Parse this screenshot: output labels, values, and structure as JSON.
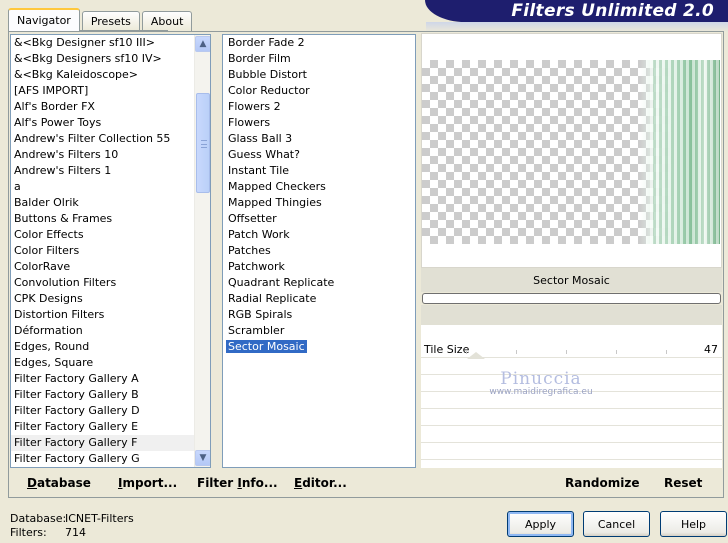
{
  "banner": {
    "title": "Filters Unlimited 2.0"
  },
  "tabs": [
    {
      "label": "Navigator",
      "active": true
    },
    {
      "label": "Presets",
      "active": false
    },
    {
      "label": "About",
      "active": false
    }
  ],
  "categories": {
    "items": [
      "&<Bkg Designer sf10 III>",
      "&<Bkg Designers sf10 IV>",
      "&<Bkg Kaleidoscope>",
      "[AFS IMPORT]",
      "Alf's Border FX",
      "Alf's Power Toys",
      "Andrew's Filter Collection 55",
      "Andrew's Filters 10",
      "Andrew's Filters 1",
      "a",
      "Balder Olrik",
      "Buttons & Frames",
      "Color Effects",
      "Color Filters",
      "ColorRave",
      "Convolution Filters",
      "CPK Designs",
      "Distortion Filters",
      "Déformation",
      "Edges, Round",
      "Edges, Square",
      "Filter Factory Gallery A",
      "Filter Factory Gallery B",
      "Filter Factory Gallery D",
      "Filter Factory Gallery E",
      "Filter Factory Gallery F",
      "Filter Factory Gallery G"
    ],
    "selected_index": 25
  },
  "filters": {
    "items": [
      "Border Fade 2",
      "Border Film",
      "Bubble Distort",
      "Color Reductor",
      "Flowers 2",
      "Flowers",
      "Glass Ball 3",
      "Guess What?",
      "Instant Tile",
      "Mapped Checkers",
      "Mapped Thingies",
      "Offsetter",
      "Patch Work",
      "Patches",
      "Patchwork",
      "Quadrant Replicate",
      "Radial Replicate",
      "RGB Spirals",
      "Scrambler",
      "Sector Mosaic"
    ],
    "selected_index": 19
  },
  "preview": {
    "filter_name": "Sector Mosaic",
    "progress": 0
  },
  "params": [
    {
      "name": "Tile Size",
      "value": "47"
    }
  ],
  "watermark": {
    "name": "Pinuccia",
    "url": "www.maidiregrafica.eu"
  },
  "toolbar": {
    "database": {
      "first": "D",
      "rest": "atabase"
    },
    "import": {
      "first": "I",
      "rest": "mport..."
    },
    "filter_info": {
      "pre": "Filter ",
      "first": "I",
      "rest": "nfo..."
    },
    "editor": {
      "first": "E",
      "rest": "ditor..."
    },
    "randomize": "Randomize",
    "reset": "Reset"
  },
  "status": {
    "database_label": "Database:",
    "database_value": "ICNET-Filters",
    "filters_label": "Filters:",
    "filters_value": "714"
  },
  "buttons": {
    "apply": "Apply",
    "cancel": "Cancel",
    "help": "Help"
  }
}
